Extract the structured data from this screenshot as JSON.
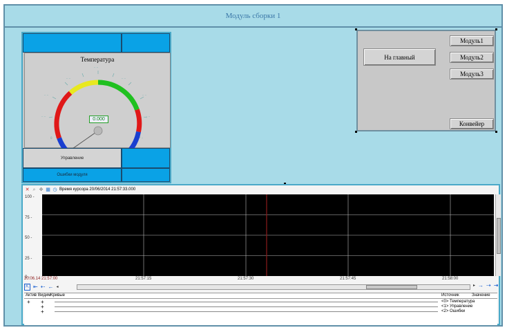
{
  "window": {
    "title": "Модуль сборки 1"
  },
  "gauge": {
    "title": "Температура",
    "value": "0.000",
    "fraction": 0.0,
    "bands": {
      "low": "#1a3fd0",
      "mid_low": "#e01818",
      "middle": "#e8e820",
      "high": "#20c020",
      "mid_high": "#e01818",
      "max": "#1a3fd0"
    }
  },
  "gauge_panel": {
    "control_label": "Управление",
    "errors_label": "Ошибки модуля"
  },
  "nav": {
    "main_label": "На главный",
    "module1_label": "Модуль1",
    "module2_label": "Модуль2",
    "module3_label": "Модуль3",
    "conveyor_label": "Конвейер"
  },
  "trend": {
    "cursor_time": "Время курсора 20/06/2014 21:57:33.000",
    "yticks": [
      "100 -",
      "75 -",
      "50 -",
      "25 -",
      "0 -"
    ],
    "xticks": [
      "20.06.14 21:57:00",
      "21:57:15",
      "21:57:30",
      "21:57:45",
      "21:58:00"
    ],
    "cursor_color": "#8b1a1a",
    "legend_headers": {
      "active": "Актив",
      "visible": "Видим",
      "curves": "Кривые",
      "source": "Источник",
      "value": "Значение"
    },
    "legend_rows": [
      {
        "source": "<0> Температура"
      },
      {
        "source": "<1> Управление"
      },
      {
        "source": "<2> Ошибки"
      }
    ]
  }
}
